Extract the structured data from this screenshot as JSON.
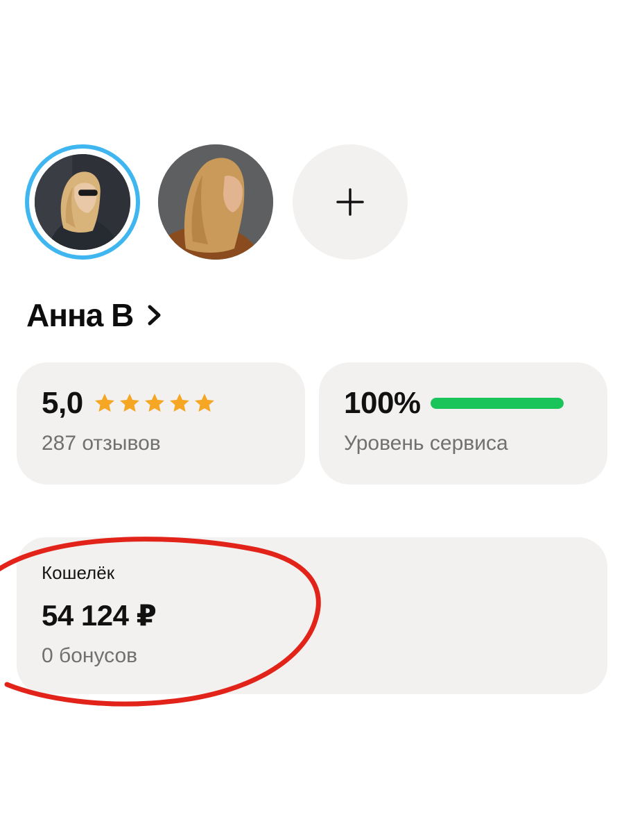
{
  "profile": {
    "name": "Анна В",
    "avatars": [
      {
        "name": "avatar-selected",
        "selected": true
      },
      {
        "name": "avatar-second",
        "selected": false
      }
    ],
    "add_avatar_icon": "plus-icon",
    "name_chevron_icon": "chevron-right-icon"
  },
  "rating": {
    "value": "5,0",
    "stars": 5,
    "reviews": "287 отзывов",
    "star_color": "#f5a623"
  },
  "service": {
    "value": "100%",
    "progress": 1.0,
    "label": "Уровень сервиса",
    "bar_color": "#1bc45a"
  },
  "wallet": {
    "title": "Кошелёк",
    "amount": "54 124 ₽",
    "bonus": "0 бонусов"
  },
  "colors": {
    "card_background": "#f2f1ef",
    "selected_ring": "#3fb6f0",
    "annotation": "#e2231a"
  }
}
